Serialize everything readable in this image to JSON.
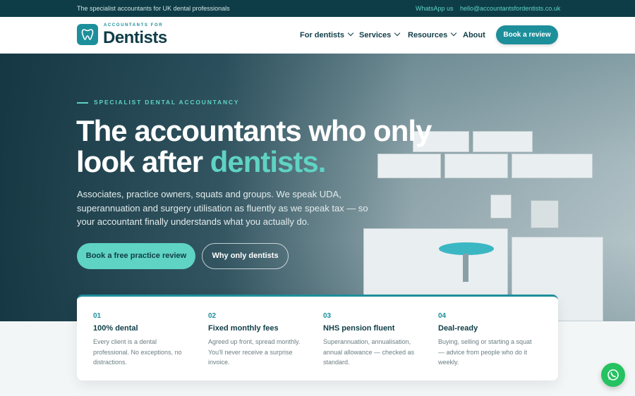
{
  "topbar": {
    "tagline": "The specialist accountants for UK dental professionals",
    "whatsapp": "WhatsApp us",
    "email": "hello@accountantsfordentists.co.uk"
  },
  "brand": {
    "small": "ACCOUNTANTS FOR",
    "big": "Dentists",
    "logo_icon": "tooth-icon"
  },
  "nav": {
    "items": [
      {
        "label": "For dentists",
        "dropdown": true
      },
      {
        "label": "Services",
        "dropdown": true
      },
      {
        "label": "Resources",
        "dropdown": true
      },
      {
        "label": "About",
        "dropdown": false
      }
    ],
    "cta": "Book a review"
  },
  "hero": {
    "eyebrow": "SPECIALIST DENTAL ACCOUNTANCY",
    "headline_line1": "The accountants who only",
    "headline_line2_prefix": "look after ",
    "headline_accent": "dentists.",
    "lede": "Associates, practice owners, squats and groups. We speak UDA, superannuation and surgery utilisation as fluently as we speak tax — so your accountant finally understands what you actually do.",
    "primary_cta": "Book a free practice review",
    "secondary_cta": "Why only dentists"
  },
  "features": [
    {
      "num": "01",
      "title": "100% dental",
      "desc": "Every client is a dental professional. No exceptions, no distractions."
    },
    {
      "num": "02",
      "title": "Fixed monthly fees",
      "desc": "Agreed up front, spread monthly. You'll never receive a surprise invoice."
    },
    {
      "num": "03",
      "title": "NHS pension fluent",
      "desc": "Superannuation, annualisation, annual allowance — checked as standard."
    },
    {
      "num": "04",
      "title": "Deal-ready",
      "desc": "Buying, selling or starting a squat — advice from people who do it weekly."
    }
  ],
  "colors": {
    "brand_dark": "#0f3d47",
    "brand_teal": "#1c8f9b",
    "accent_mint": "#5fd3c4",
    "whatsapp_green": "#25c261"
  }
}
